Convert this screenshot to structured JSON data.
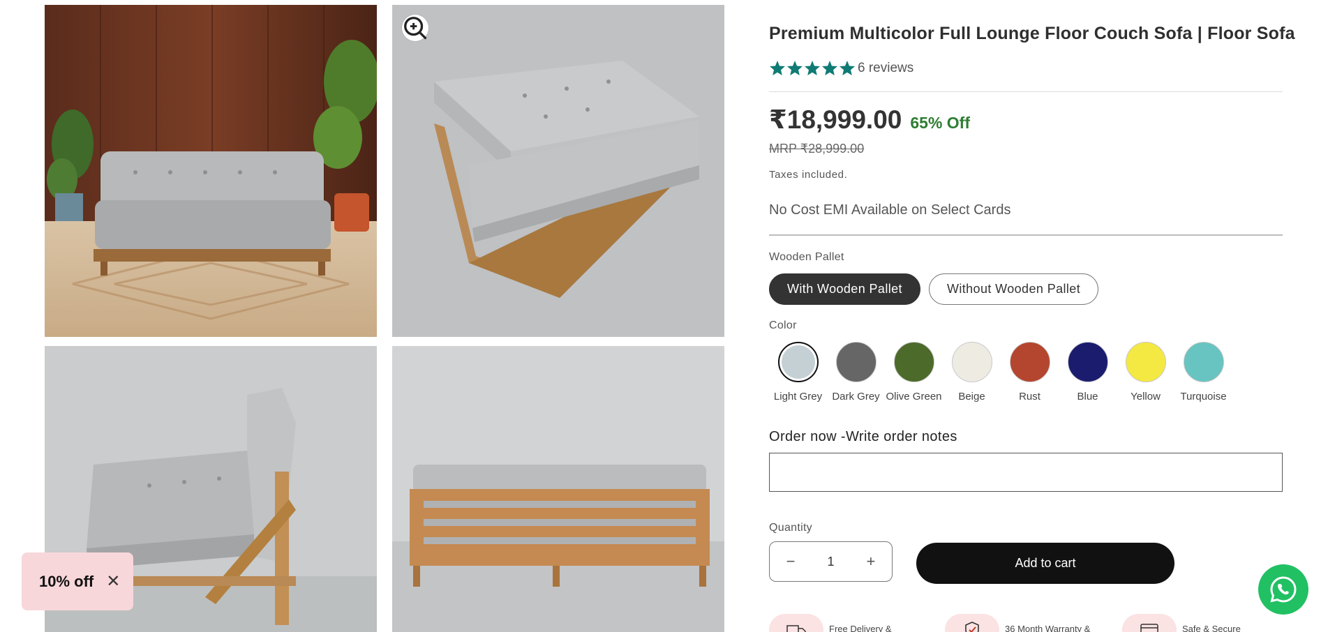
{
  "gallery": {
    "images": [
      {
        "alt": "sofa-front-wood-room"
      },
      {
        "alt": "sofa-angled-grey-bg"
      },
      {
        "alt": "sofa-side-view"
      },
      {
        "alt": "sofa-back-view"
      }
    ],
    "zoom_icon": "zoom-in-icon"
  },
  "product": {
    "title": "Premium Multicolor Full Lounge Floor Couch Sofa | Floor Sofa",
    "rating": 5,
    "reviews_text": "6 reviews",
    "price": "₹18,999.00",
    "discount": "65% Off",
    "mrp": "MRP ₹28,999.00",
    "tax_note": "Taxes included.",
    "emi_note": "No Cost EMI Available on Select Cards",
    "star_color": "#0f7b74"
  },
  "options": {
    "pallet": {
      "label": "Wooden Pallet",
      "values": [
        "With Wooden Pallet",
        "Without Wooden Pallet"
      ],
      "selected": "With Wooden Pallet"
    },
    "color": {
      "label": "Color",
      "selected": "Light Grey",
      "values": [
        {
          "name": "Light Grey",
          "hex": "#c5d0d4"
        },
        {
          "name": "Dark Grey",
          "hex": "#666666"
        },
        {
          "name": "Olive Green",
          "hex": "#4c6a2a"
        },
        {
          "name": "Beige",
          "hex": "#eeebe3"
        },
        {
          "name": "Rust",
          "hex": "#b4452e"
        },
        {
          "name": "Blue",
          "hex": "#1b1c6e"
        },
        {
          "name": "Yellow",
          "hex": "#f4e843"
        },
        {
          "name": "Turquoise",
          "hex": "#68c4c0"
        }
      ]
    }
  },
  "order_notes": {
    "label": "Order now -Write order notes",
    "value": ""
  },
  "quantity": {
    "label": "Quantity",
    "value": "1",
    "minus": "−",
    "plus": "+"
  },
  "cart": {
    "add_label": "Add to cart"
  },
  "features": [
    {
      "icon": "truck-icon",
      "text": "Free Delivery &"
    },
    {
      "icon": "shield-check-icon",
      "text": "36 Month Warranty &"
    },
    {
      "icon": "credit-card-icon",
      "text": "Safe & Secure"
    }
  ],
  "promo": {
    "label": "10% off",
    "close": "✕"
  },
  "whatsapp": {
    "icon": "whatsapp-icon"
  }
}
